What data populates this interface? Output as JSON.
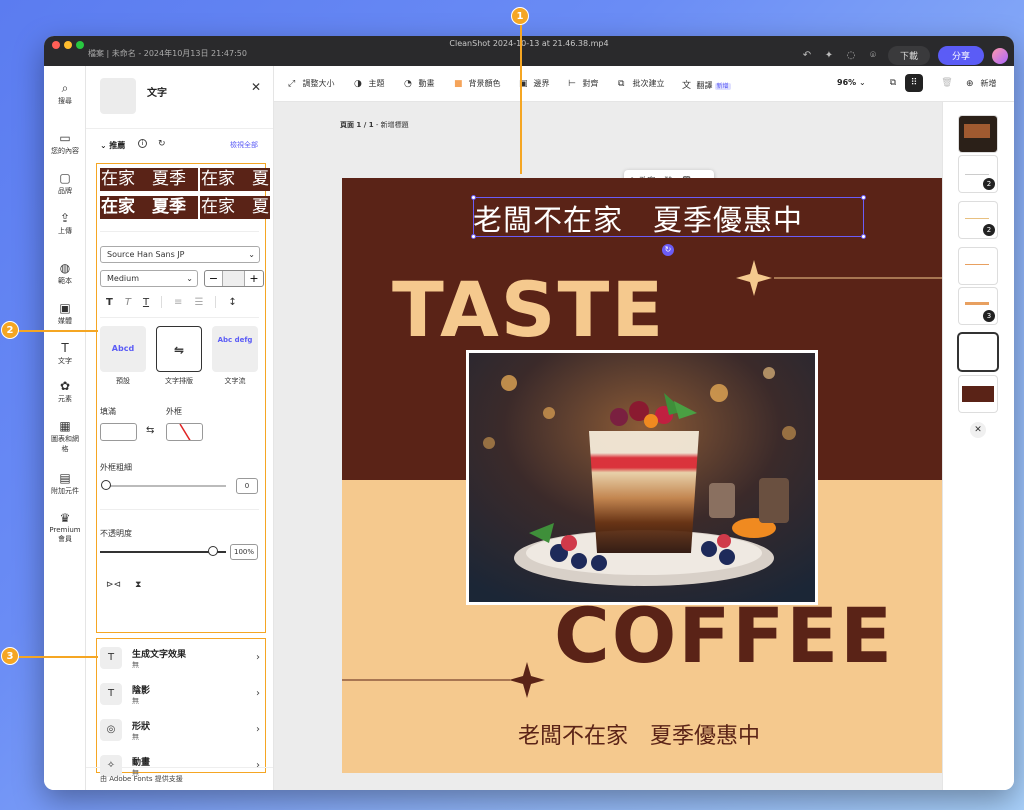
{
  "titlebar": {
    "title": "CleanShot 2024-10-13 at 21.46.38.mp4",
    "breadcrumb": "檔案  |  未命名 - 2024年10月13日 21:47:50",
    "download_label": "下載",
    "share_label": "分享"
  },
  "rail": [
    {
      "icon": "⌕",
      "label": "搜尋"
    },
    {
      "icon": "▭",
      "label": "您的內容"
    },
    {
      "icon": "▢",
      "label": "品牌"
    },
    {
      "icon": "⇪",
      "label": "上傳"
    },
    {
      "icon": "◍",
      "label": "範本"
    },
    {
      "icon": "▣",
      "label": "媒體"
    },
    {
      "icon": "T",
      "label": "文字"
    },
    {
      "icon": "✿",
      "label": "元素"
    },
    {
      "icon": "▦",
      "label": "圖表和網格"
    },
    {
      "icon": "▤",
      "label": "附加元件"
    },
    {
      "icon": "♛",
      "label": "Premium 會員"
    }
  ],
  "panel": {
    "title": "文字",
    "recommend_title": "推薦",
    "view_all": "檢視全部",
    "samples": [
      "在家　夏季",
      "在家　夏",
      "在家　夏季",
      "在家　夏"
    ],
    "font_family": "Source Han Sans JP",
    "font_weight": "Medium",
    "style_cards": [
      {
        "preview": "Abcd",
        "label": "預設"
      },
      {
        "preview": "⇋",
        "label": "文字排版"
      },
      {
        "preview": "Abc defg",
        "label": "文字流"
      }
    ],
    "fill_label": "填滿",
    "stroke_label": "外框",
    "stroke_width_label": "外框粗細",
    "stroke_width_value": "0",
    "opacity_label": "不透明度",
    "opacity_value": "100%",
    "effects": [
      {
        "icon": "T",
        "title": "生成文字效果",
        "sub": "無"
      },
      {
        "icon": "T",
        "title": "陰影",
        "sub": "無"
      },
      {
        "icon": "◎",
        "title": "形狀",
        "sub": "無"
      },
      {
        "icon": "✧",
        "title": "動畫",
        "sub": "無"
      }
    ],
    "footer": "由 Adobe Fonts 提供支援"
  },
  "toolbar": {
    "items": [
      {
        "icon": "⤢",
        "label": "調整大小"
      },
      {
        "icon": "◑",
        "label": "主題"
      },
      {
        "icon": "◔",
        "label": "動畫"
      },
      {
        "icon": "■",
        "label": "背景顏色"
      },
      {
        "icon": "▣",
        "label": "邊界"
      },
      {
        "icon": "⊢",
        "label": "對齊"
      },
      {
        "icon": "⧉",
        "label": "批次建立"
      },
      {
        "icon": "文",
        "label": "翻譯",
        "badge": "新增"
      }
    ],
    "zoom": "96%",
    "add_label": "新增"
  },
  "canvas": {
    "page_label_bold": "頁面 1 / 1",
    "page_label_rest": " - 新增標題",
    "headline_top": "老闆不在家　夏季優惠中",
    "taste": "TASTE",
    "coffee": "COFFEE",
    "headline_bottom": "老闆不在家　夏季優惠中",
    "float_toolbar_label": "改寫"
  },
  "pages": [
    {
      "count": ""
    },
    {
      "count": "2"
    },
    {
      "count": "2"
    },
    {
      "count": ""
    },
    {
      "count": "3"
    },
    {
      "count": ""
    },
    {
      "count": ""
    }
  ],
  "callouts": [
    "1",
    "2",
    "3"
  ],
  "colors": {
    "poster_brown": "#5a2317",
    "poster_tan": "#f5c98e",
    "accent": "#5b5cf6",
    "callout_orange": "#f5a623"
  }
}
